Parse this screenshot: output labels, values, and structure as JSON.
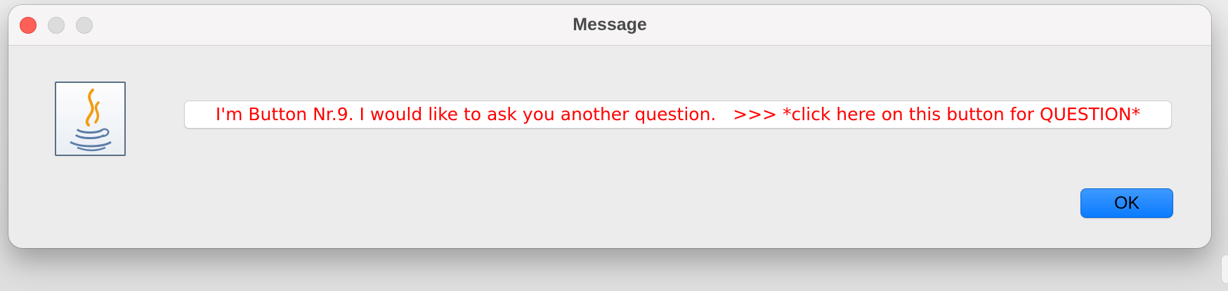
{
  "window": {
    "title": "Message"
  },
  "dialog": {
    "icon": "java-coffee-cup-icon",
    "question_button_label": "I'm Button Nr.9. I would like to ask you another question.   >>> *click here on this button for QUESTION*",
    "question_button_color": "#ff0000",
    "ok_label": "OK",
    "ok_color": "#0a7bff"
  },
  "traffic_lights": {
    "close_color": "#fe5f57",
    "inactive_color": "#dcdcdc"
  }
}
